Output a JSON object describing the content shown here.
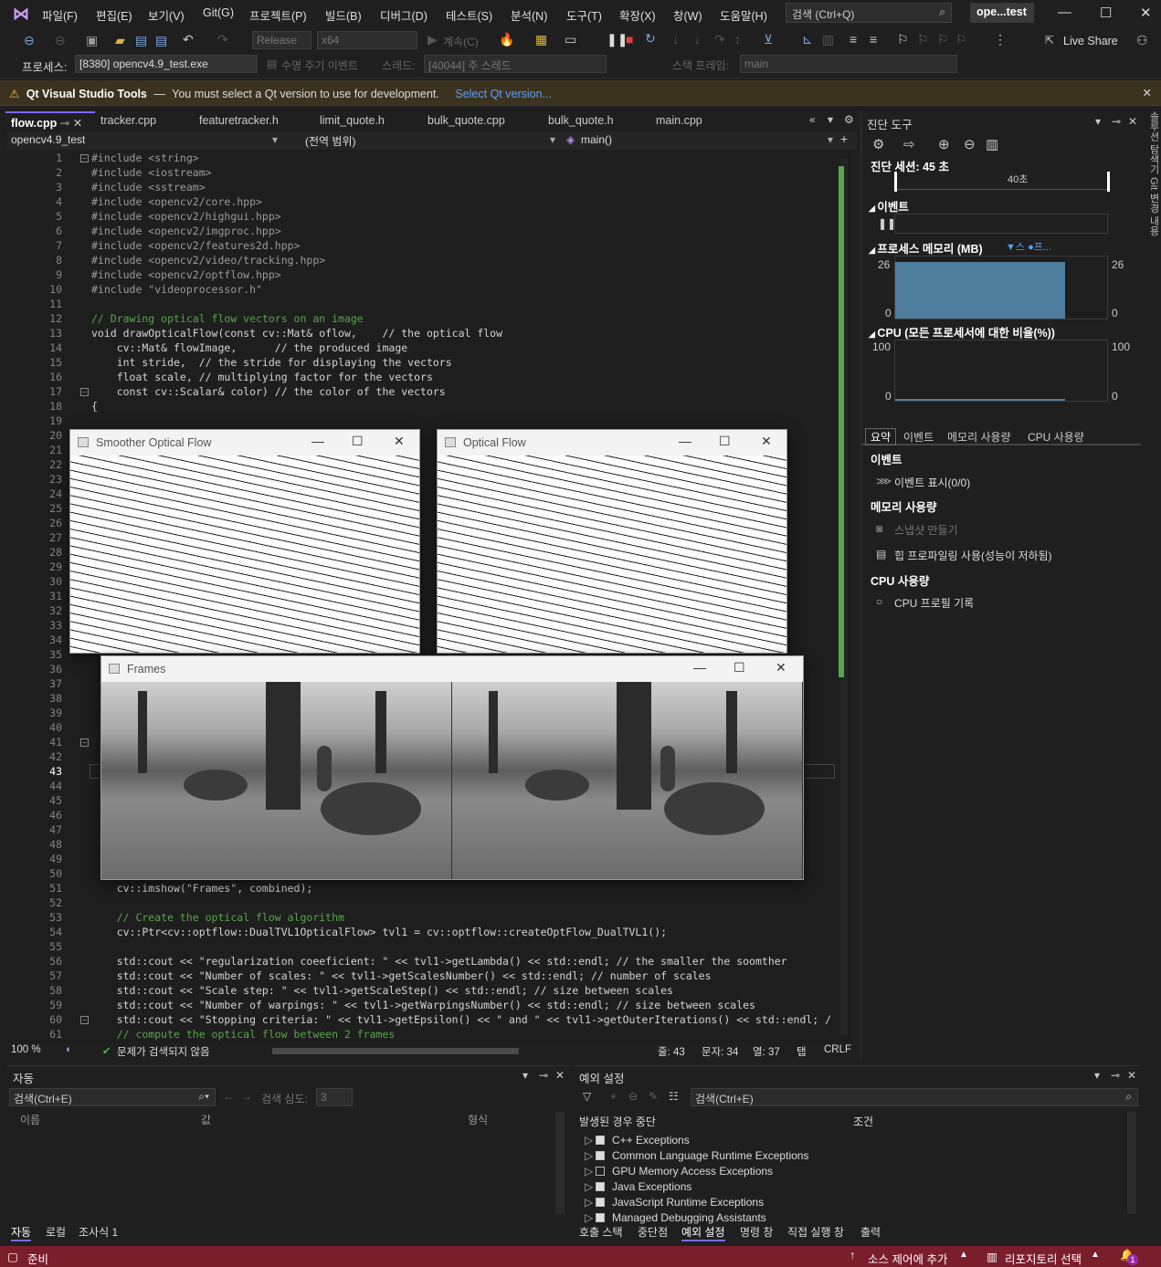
{
  "menu": {
    "items": [
      "파일(F)",
      "편집(E)",
      "보기(V)",
      "Git(G)",
      "프로젝트(P)",
      "빌드(B)",
      "디버그(D)",
      "테스트(S)",
      "분석(N)",
      "도구(T)",
      "확장(X)",
      "창(W)",
      "도움말(H)"
    ],
    "search": "검색 (Ctrl+Q)",
    "solution": "ope...test"
  },
  "toolbar": {
    "config": "Release",
    "platform": "x64",
    "continue": "계속(C)",
    "live_share": "Live Share",
    "process_label": "프로세스:",
    "process": "[8380] opencv4.9_test.exe",
    "lifecycle": "수명 주기 이벤트",
    "thread_label": "스레드:",
    "thread": "[40044] 주 스레드",
    "stack_label": "스택 프레임:",
    "stack": "main"
  },
  "qt": {
    "title": "Qt Visual Studio Tools",
    "sep": "—",
    "message": "You must select a Qt version to use for development.",
    "link": "Select Qt version..."
  },
  "tabs": [
    "flow.cpp",
    "tracker.cpp",
    "featuretracker.h",
    "limit_quote.h",
    "bulk_quote.cpp",
    "bulk_quote.h",
    "main.cpp"
  ],
  "nav": {
    "project": "opencv4.9_test",
    "scope": "(전역 범위)",
    "member": "main()"
  },
  "code": {
    "line_numbers": [
      "1",
      "2",
      "3",
      "4",
      "5",
      "6",
      "7",
      "8",
      "9",
      "10",
      "11",
      "12",
      "13",
      "14",
      "15",
      "16",
      "17",
      "18",
      "19",
      "20",
      "21",
      "22",
      "23",
      "24",
      "25",
      "26",
      "27",
      "28",
      "29",
      "30",
      "31",
      "32",
      "33",
      "34",
      "35",
      "36",
      "37",
      "38",
      "39",
      "40",
      "41",
      "42",
      "43",
      "44",
      "45",
      "46",
      "47",
      "48",
      "49",
      "50",
      "51",
      "52",
      "53",
      "54",
      "55",
      "56",
      "57",
      "58",
      "59",
      "60",
      "61"
    ],
    "lines": [
      "#include <string>",
      "#include <iostream>",
      "#include <sstream>",
      "#include <opencv2/core.hpp>",
      "#include <opencv2/highgui.hpp>",
      "#include <opencv2/imgproc.hpp>",
      "#include <opencv2/features2d.hpp>",
      "#include <opencv2/video/tracking.hpp>",
      "#include <opencv2/optflow.hpp>",
      "#include \"videoprocessor.h\"",
      "// Drawing optical flow vectors on an image",
      "void drawOpticalFlow(const cv::Mat& oflow,    // the optical flow",
      "    cv::Mat& flowImage,      // the produced image",
      "    int stride,  // the stride for displaying the vectors",
      "    float scale, // multiplying factor for the vectors",
      "    const cv::Scalar& color) // the color of the vectors",
      "{",
      "    cv::imshow(\"Frames\", combined);",
      "    // Create the optical flow algorithm",
      "    cv::Ptr<cv::optflow::DualTVL1OpticalFlow> tvl1 = cv::optflow::createOptFlow_DualTVL1();",
      "    std::cout << \"regularization coeeficient: \" << tvl1->getLambda() << std::endl; // the smaller the soomther",
      "    std::cout << \"Number of scales: \" << tvl1->getScalesNumber() << std::endl; // number of scales",
      "    std::cout << \"Scale step: \" << tvl1->getScaleStep() << std::endl; // size between scales",
      "    std::cout << \"Number of warpings: \" << tvl1->getWarpingsNumber() << std::endl; // size between scales",
      "    std::cout << \"Stopping criteria: \" << tvl1->getEpsilon() << \" and \" << tvl1->getOuterIterations() << std::endl; /",
      "    // compute the optical flow between 2 frames"
    ]
  },
  "editor_status": {
    "zoom": "100 %",
    "issues": "문제가 검색되지 않음",
    "line": "줄: 43",
    "char": "문자: 34",
    "col": "열: 37",
    "tab": "탭",
    "crlf": "CRLF"
  },
  "windows": {
    "smoother": "Smoother Optical Flow",
    "optical": "Optical Flow",
    "frames": "Frames"
  },
  "diag": {
    "title": "진단 도구",
    "session": "진단 세션: 45 초",
    "tick": "40초",
    "events": "이벤트",
    "memory": "프로세스 메모리 (MB)",
    "mem_max": "26",
    "mem_min": "0",
    "mem_legend": "▼스  ●프...",
    "cpu": "CPU (모든 프로세서에 대한 비율(%))",
    "cpu_max": "100",
    "cpu_min": "0",
    "tabs": [
      "요약",
      "이벤트",
      "메모리 사용량",
      "CPU 사용량"
    ],
    "events_hd": "이벤트",
    "show_events": "이벤트 표시(0/0)",
    "memory_hd": "메모리 사용량",
    "snapshot": "스냅샷 만들기",
    "heap": "힙 프로파일링 사용(성능이 저하됨)",
    "cpu_hd": "CPU 사용량",
    "cpu_profile": "CPU 프로필 기록"
  },
  "sidebar": "솔루션 탐색기  Git 변경 내용",
  "autos": {
    "title": "자동",
    "search": "검색(Ctrl+E)",
    "depth": "검색 심도:",
    "depth_val": "3",
    "col_name": "이름",
    "col_value": "값",
    "col_type": "형식",
    "tabs": [
      "자동",
      "로컬",
      "조사식 1"
    ]
  },
  "exceptions": {
    "title": "예외 설정",
    "search": "검색(Ctrl+E)",
    "col_break": "발생된 경우 중단",
    "col_cond": "조건",
    "items": [
      {
        "name": "C++ Exceptions",
        "on": true
      },
      {
        "name": "Common Language Runtime Exceptions",
        "on": true
      },
      {
        "name": "GPU Memory Access Exceptions",
        "on": false
      },
      {
        "name": "Java Exceptions",
        "on": true
      },
      {
        "name": "JavaScript Runtime Exceptions",
        "on": true
      },
      {
        "name": "Managed Debugging Assistants",
        "on": true
      }
    ],
    "tabs": [
      "호출 스택",
      "중단점",
      "예외 설정",
      "명령 창",
      "직접 실행 창",
      "출력"
    ]
  },
  "status": {
    "ready": "준비",
    "add_source": "소스 제어에 추가",
    "repo": "리포지토리 선택",
    "notif": "1"
  }
}
